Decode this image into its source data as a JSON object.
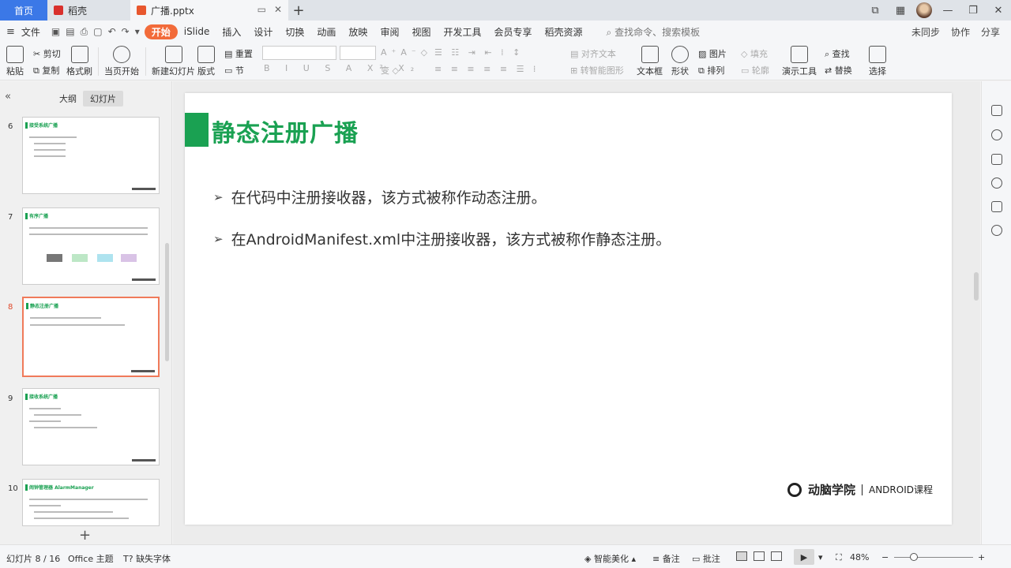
{
  "tabs": {
    "home": "首页",
    "daoke": "稻壳",
    "doc": "广播.pptx",
    "add": "+"
  },
  "menu": {
    "file": "文件",
    "items": [
      "开始",
      "iSlide",
      "插入",
      "设计",
      "切换",
      "动画",
      "放映",
      "审阅",
      "视图",
      "开发工具",
      "会员专享",
      "稻壳资源"
    ],
    "active_index": 0,
    "search": "查找命令、搜索模板",
    "right": [
      "未同步",
      "协作",
      "分享"
    ]
  },
  "ribbon": {
    "paste": "粘贴",
    "cut": "剪切",
    "copy": "复制",
    "format_painter": "格式刷",
    "start_from_current": "当页开始",
    "new_slide": "新建幻灯片",
    "layout": "版式",
    "section": "节",
    "reset": "重置",
    "align_text": "对齐文本",
    "smart_art": "转智能图形",
    "textbox": "文本框",
    "shape": "形状",
    "picture": "图片",
    "fill": "填充",
    "arrange": "排列",
    "outline": "轮廓",
    "presenter": "演示工具",
    "find": "查找",
    "replace": "替换",
    "select": "选择"
  },
  "left_panel": {
    "tab_outline": "大纲",
    "tab_slides": "幻灯片",
    "thumbnails": [
      {
        "num": "6",
        "title": "接受系统广播"
      },
      {
        "num": "7",
        "title": "有序广播"
      },
      {
        "num": "8",
        "title": "静态注册广播"
      },
      {
        "num": "9",
        "title": "接收系统广播"
      },
      {
        "num": "10",
        "title": "闹钟管理器 AlarmManager"
      }
    ],
    "selected_num": "8"
  },
  "slide": {
    "title": "静态注册广播",
    "bullets": [
      "在代码中注册接收器，该方式被称作动态注册。",
      "在AndroidManifest.xml中注册接收器，该方式被称作静态注册。"
    ],
    "bullet_marker": "➢",
    "footer_logo": "动脑学院",
    "footer_course": "ANDROID课程"
  },
  "status": {
    "slide_pos": "幻灯片 8 / 16",
    "theme": "Office 主题",
    "missing_font": "缺失字体",
    "beautify": "智能美化",
    "notes": "备注",
    "comments": "批注",
    "zoom": "48%"
  },
  "colors": {
    "accent_green": "#1aa152",
    "home_tab": "#3b78e7",
    "active_menu": "#f26b3a",
    "selected_thumb": "#f07a5a"
  }
}
